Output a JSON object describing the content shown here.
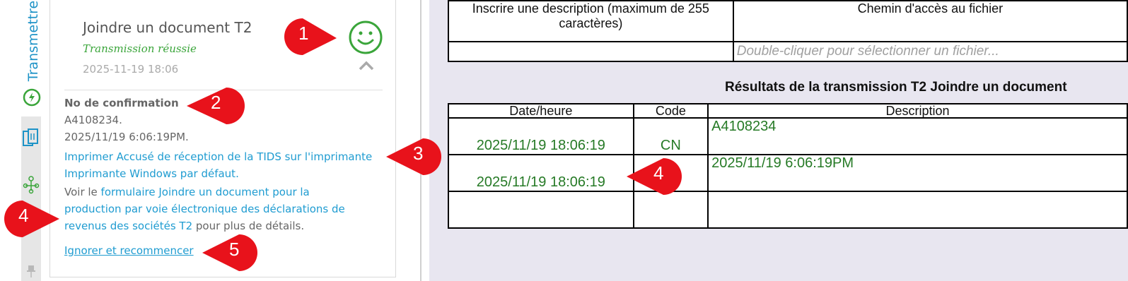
{
  "sidebar": {
    "tab_label": "Transmettre"
  },
  "panel": {
    "title": "Joindre un document T2",
    "status": "Transmission réussie",
    "date": "2025-11-19 18:06",
    "confirmation_heading": "No de confirmation",
    "confirmation_number": "A4108234.",
    "confirmation_time": "2025/11/19 6:06:19PM.",
    "print_link_line1": "Imprimer Accusé de réception de la TIDS sur l'imprimante",
    "print_link_line2": "Imprimante Windows par défaut.",
    "see_prefix": "Voir le ",
    "form_link_line1": "formulaire Joindre un document pour la",
    "form_link_line2": "production par voie électronique des déclarations de",
    "form_link_line3": "revenus des sociétés T2",
    "see_suffix": " pour plus de détails.",
    "ignore_link": "Ignorer et recommencer"
  },
  "document_table": {
    "headers": [
      "Inscrire une description (maximum de 255 caractères)",
      "Chemin d'accès au fichier"
    ],
    "file_placeholder": "Double-cliquer pour sélectionner un fichier..."
  },
  "results": {
    "title": "Résultats de la transmission T2 Joindre un document",
    "headers": [
      "Date/heure",
      "Code",
      "Description"
    ],
    "rows": [
      {
        "datetime": "2025/11/19 18:06:19",
        "code": "CN",
        "description": "A4108234"
      },
      {
        "datetime": "2025/11/19 18:06:19",
        "code": "",
        "description": "2025/11/19 6:06:19PM"
      },
      {
        "datetime": "",
        "code": "",
        "description": ""
      }
    ]
  },
  "callouts": [
    "1",
    "2",
    "3",
    "4",
    "4",
    "5"
  ],
  "colors": {
    "success": "#3aa53a",
    "link": "#1f9cd1",
    "callout": "#e8121b",
    "form_bg": "#e8e6f0"
  }
}
